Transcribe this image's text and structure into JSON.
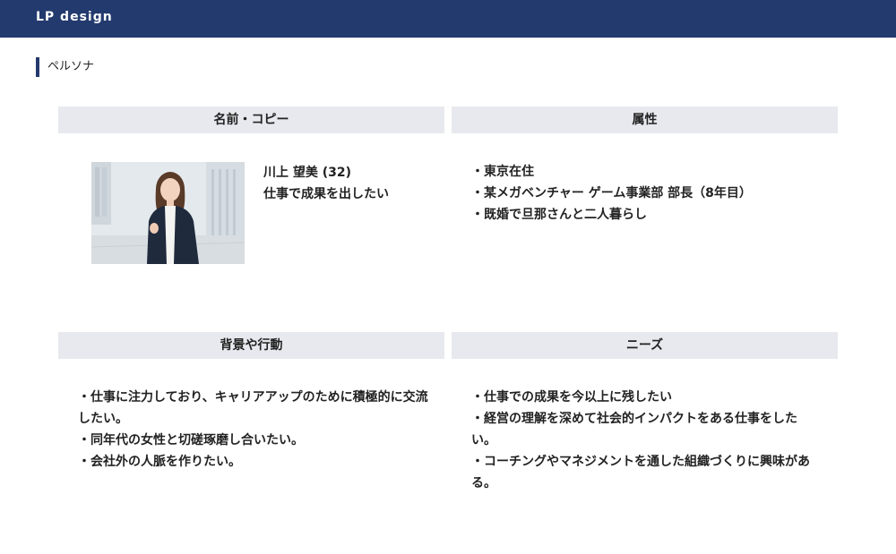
{
  "header": {
    "title": "LP design",
    "background_color": "#233a6e"
  },
  "section": {
    "title": "ペルソナ"
  },
  "panels": {
    "name_copy": {
      "header": "名前・コピー",
      "name": "川上 望美 (32)",
      "copy": "仕事で成果を出したい",
      "photo_icon": "persona-photo"
    },
    "attributes": {
      "header": "属性",
      "items": [
        "・東京在住",
        "・某メガベンチャー ゲーム事業部 部長（8年目）",
        "・既婚で旦那さんと二人暮らし"
      ]
    },
    "background": {
      "header": "背景や行動",
      "items": [
        "・仕事に注力しており、キャリアアップのために積極的に交流したい。",
        "・同年代の女性と切磋琢磨し合いたい。",
        "・会社外の人脈を作りたい。"
      ]
    },
    "needs": {
      "header": "ニーズ",
      "items": [
        "・仕事での成果を今以上に残したい",
        "・経営の理解を深めて社会的インパクトをある仕事をしたい。",
        "・コーチングやマネジメントを通した組織づくりに興味がある。"
      ]
    }
  },
  "colors": {
    "accent": "#233a6e",
    "panel_header_bg": "#e8e9ee"
  }
}
